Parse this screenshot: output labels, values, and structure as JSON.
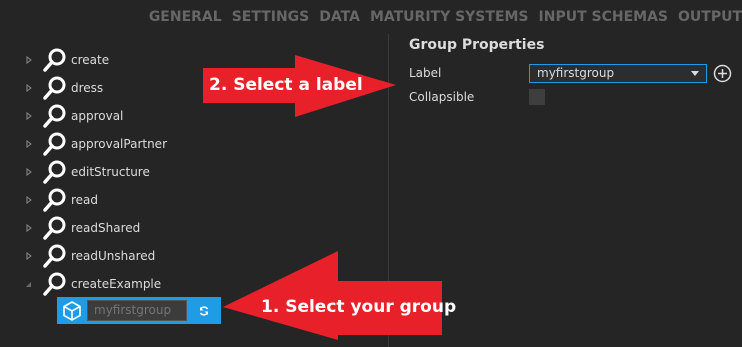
{
  "topnav": {
    "items": [
      "GENERAL",
      "SETTINGS",
      "DATA",
      "MATURITY SYSTEMS",
      "INPUT SCHEMAS",
      "OUTPUT"
    ]
  },
  "tree": {
    "items": [
      {
        "label": "create",
        "expanded": false
      },
      {
        "label": "dress",
        "expanded": false
      },
      {
        "label": "approval",
        "expanded": false
      },
      {
        "label": "approvalPartner",
        "expanded": false
      },
      {
        "label": "editStructure",
        "expanded": false
      },
      {
        "label": "read",
        "expanded": false
      },
      {
        "label": "readShared",
        "expanded": false
      },
      {
        "label": "readUnshared",
        "expanded": false
      },
      {
        "label": "createExample",
        "expanded": true
      }
    ],
    "selected_group": {
      "placeholder": "myfirstgroup",
      "icon": "cube-icon",
      "action_icon": "refresh-icon"
    }
  },
  "properties": {
    "title": "Group Properties",
    "label_field": {
      "label": "Label",
      "value": "myfirstgroup"
    },
    "collapsible_field": {
      "label": "Collapsible",
      "checked": false
    }
  },
  "callouts": {
    "select_label": "2. Select a label",
    "select_group": "1. Select your group"
  },
  "colors": {
    "background": "#252526",
    "accent": "#1e9ce6",
    "callout": "#e8202a",
    "nav_text": "#676767"
  }
}
